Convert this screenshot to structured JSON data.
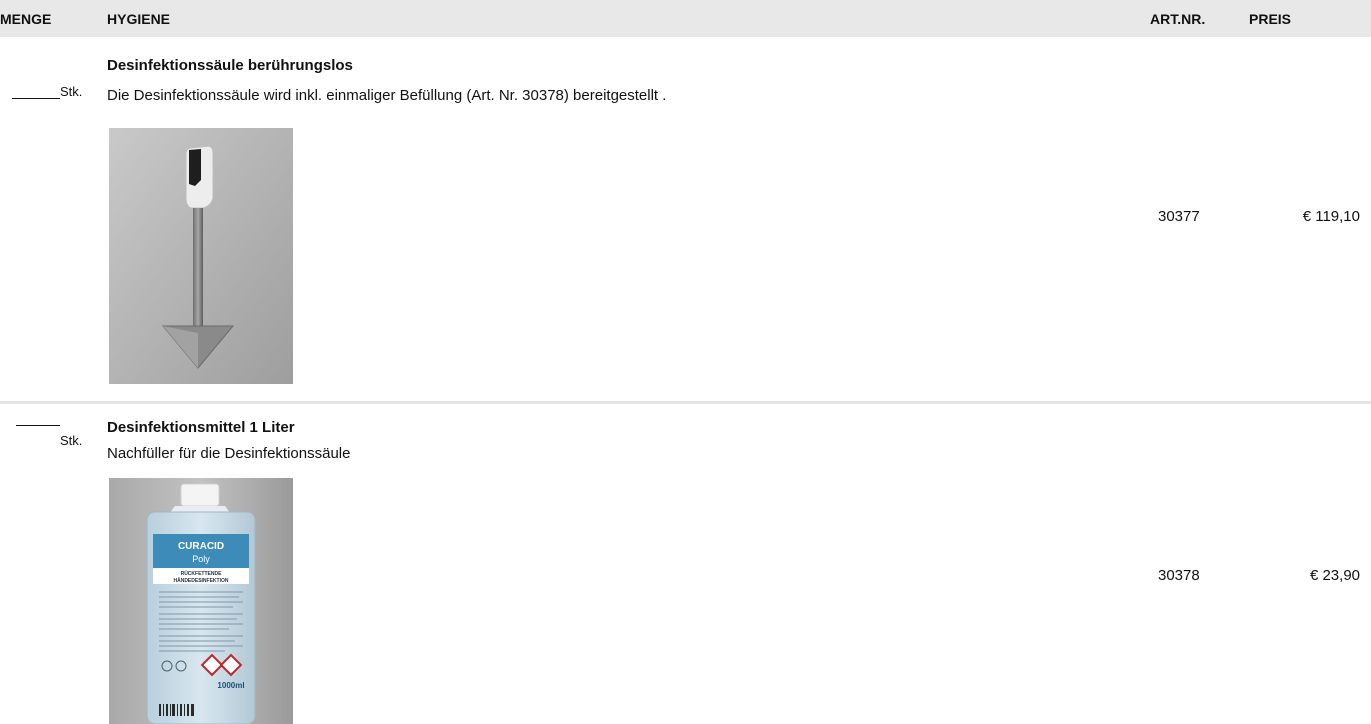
{
  "header": {
    "menge": "MENGE",
    "hygiene": "HYGIENE",
    "artnr": "ART.NR.",
    "preis": "PREIS"
  },
  "products": [
    {
      "title": "Desinfektionssäule berührungslos",
      "description": "Die Desinfektionssäule wird inkl. einmaliger Befüllung  (Art. Nr. 30378) bereitgestellt .",
      "unit": "Stk.",
      "artnr": "30377",
      "price": "€ 119,10",
      "image_icon": "disinfection-stand-photo"
    },
    {
      "title": "Desinfektionsmittel 1 Liter",
      "description": "Nachfüller für die Desinfektionssäule",
      "unit": "Stk.",
      "artnr": "30378",
      "price": "€ 23,90",
      "image_icon": "disinfectant-bottle-photo",
      "label": {
        "brand": "CURACID",
        "name": "Poly",
        "line1": "RÜCKFETTENDE",
        "line2": "HÄNDEDESINFEKTION",
        "volume": "1000ml"
      }
    }
  ]
}
